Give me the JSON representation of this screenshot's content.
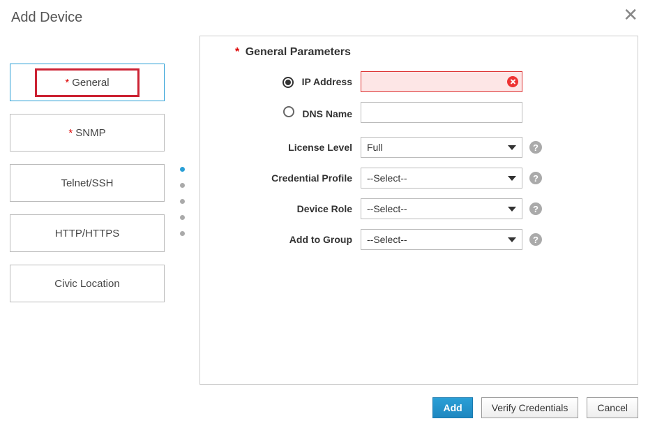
{
  "title": "Add Device",
  "tabs": [
    {
      "label": "General",
      "required": true,
      "active": true
    },
    {
      "label": "SNMP",
      "required": true,
      "active": false
    },
    {
      "label": "Telnet/SSH",
      "required": false,
      "active": false
    },
    {
      "label": "HTTP/HTTPS",
      "required": false,
      "active": false
    },
    {
      "label": "Civic Location",
      "required": false,
      "active": false
    }
  ],
  "panel": {
    "heading": "General Parameters",
    "heading_required": true,
    "fields": {
      "ip_address": {
        "label": "IP Address",
        "value": "",
        "selected": true,
        "error": true
      },
      "dns_name": {
        "label": "DNS Name",
        "value": "",
        "selected": false
      },
      "license_level": {
        "label": "License Level",
        "value": "Full"
      },
      "credential_profile": {
        "label": "Credential Profile",
        "value": "--Select--"
      },
      "device_role": {
        "label": "Device Role",
        "value": "--Select--"
      },
      "add_to_group": {
        "label": "Add to Group",
        "value": "--Select--"
      }
    }
  },
  "buttons": {
    "add": "Add",
    "verify": "Verify Credentials",
    "cancel": "Cancel"
  },
  "glyphs": {
    "question": "?",
    "star": "*"
  }
}
